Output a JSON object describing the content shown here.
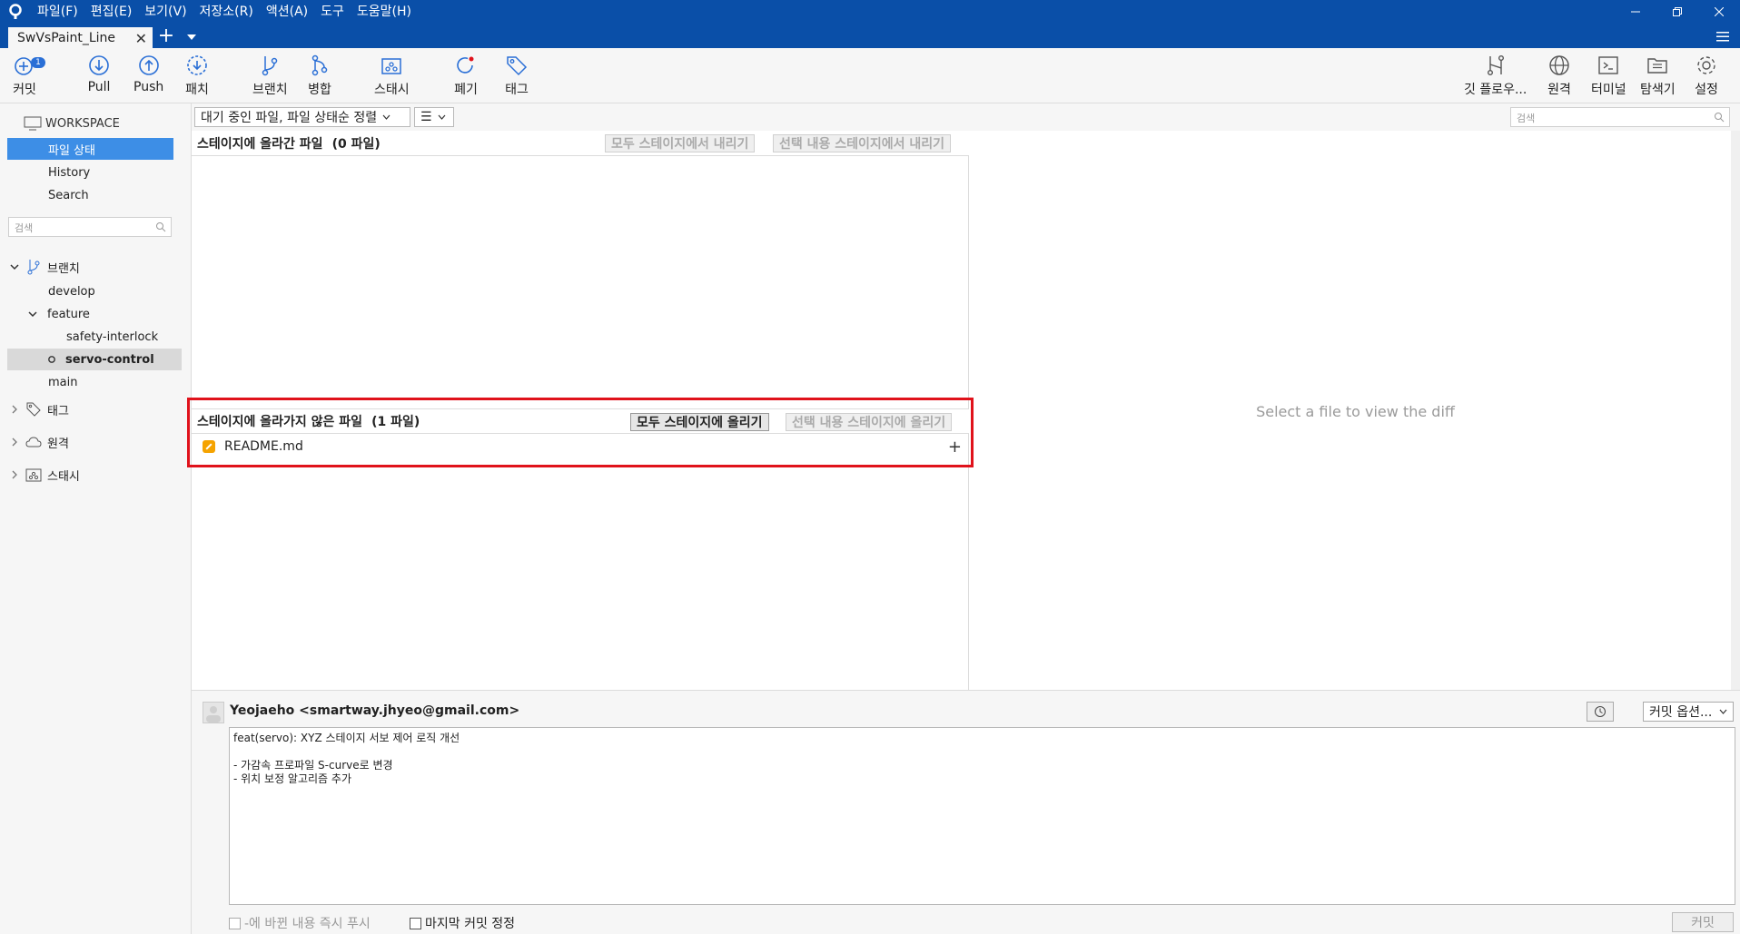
{
  "menu": [
    "파일(F)",
    "편집(E)",
    "보기(V)",
    "저장소(R)",
    "액션(A)",
    "도구",
    "도움말(H)"
  ],
  "tab": {
    "title": "SwVsPaint_Line"
  },
  "toolbar": {
    "commit": "커밋",
    "commit_badge": "1",
    "pull": "Pull",
    "push": "Push",
    "patch": "패치",
    "branch": "브랜치",
    "merge": "병합",
    "stash": "스태시",
    "discard": "폐기",
    "tag": "태그",
    "gitflow": "깃 플로우...",
    "remote": "원격",
    "terminal": "터미널",
    "explorer": "탐색기",
    "settings": "설정"
  },
  "sidebar": {
    "workspace": "WORKSPACE",
    "file_status": "파일 상태",
    "history": "History",
    "search": "Search",
    "search_placeholder": "검색",
    "branches": "브랜치",
    "develop": "develop",
    "feature": "feature",
    "safety": "safety-interlock",
    "servo": "servo-control",
    "main": "main",
    "tags": "태그",
    "remotes": "원격",
    "stashes": "스태시"
  },
  "filter": {
    "sort": "대기 중인 파일, 파일 상태순 정렬",
    "view": "☰",
    "search_placeholder": "검색"
  },
  "staged": {
    "title": "스테이지에 올라간 파일",
    "count": "(0 파일)",
    "unstage_all": "모두 스테이지에서 내리기",
    "unstage_sel": "선택 내용 스테이지에서 내리기"
  },
  "unstaged": {
    "title": "스테이지에 올라가지 않은 파일",
    "count": "(1 파일)",
    "stage_all": "모두 스테이지에 올리기",
    "stage_sel": "선택 내용 스테이지에 올리기",
    "files": [
      "README.md"
    ]
  },
  "diff": {
    "placeholder": "Select a file to view the diff"
  },
  "commit": {
    "author": "Yeojaeho <smartway.jhyeo@gmail.com>",
    "options": "커밋 옵션...",
    "message": "feat(servo): XYZ 스테이지 서보 제어 로직 개선\n\n- 가감속 프로파일 S-curve로 변경\n- 위치 보정 알고리즘 추가",
    "push_now": "-에 바뀐 내용 즉시 푸시",
    "amend": "마지막 커밋 정정",
    "button": "커밋"
  },
  "colors": {
    "titlebar": "#0a4fa8",
    "selection": "#3d8ee6",
    "highlight": "#e0121b",
    "modified": "#f5a300"
  }
}
